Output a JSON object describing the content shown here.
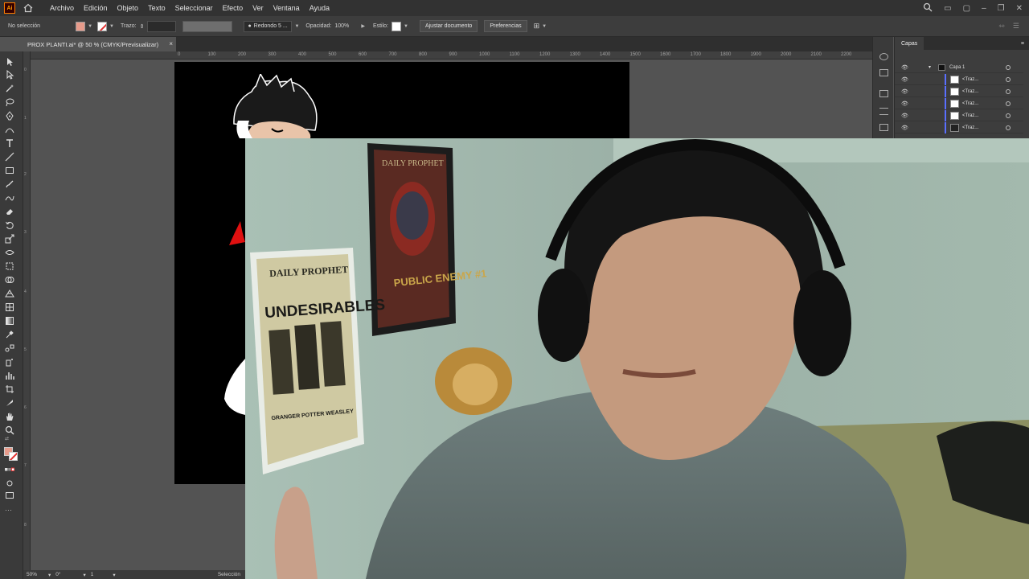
{
  "menubar": {
    "logo": "Ai",
    "items": [
      "Archivo",
      "Edición",
      "Objeto",
      "Texto",
      "Seleccionar",
      "Efecto",
      "Ver",
      "Ventana",
      "Ayuda"
    ]
  },
  "controlbar": {
    "selection": "No selección",
    "stroke_label": "Trazo:",
    "brush": "Redondo 5 ...",
    "opacity_label": "Opacidad:",
    "opacity_value": "100%",
    "style_label": "Estilo:",
    "adjust_button": "Ajustar documento",
    "prefs_button": "Preferencias"
  },
  "document_tab": {
    "title": "PROX PLANTI.ai* @ 50 % (CMYK/Previsualizar)",
    "close": "×"
  },
  "hruler_ticks": [
    "0",
    "100",
    "200",
    "300",
    "400",
    "500",
    "600",
    "700",
    "800",
    "900",
    "1000",
    "1100",
    "1200",
    "1300",
    "1400",
    "1500",
    "1600",
    "1700",
    "1800",
    "1900",
    "2000",
    "2100",
    "2200"
  ],
  "layers_panel": {
    "tab": "Capas",
    "parent": "Capa 1",
    "children": [
      "<Traz...",
      "<Traz...",
      "<Traz...",
      "<Traz...",
      "<Traz..."
    ]
  },
  "statusbar": {
    "zoom": "50%",
    "rotation": "0°",
    "artboard": "1",
    "tool": "Selección"
  },
  "webcam": {
    "poster1_title": "DAILY PROPHET",
    "poster1_headline": "UNDESIRABLES",
    "poster1_names": "GRANGER  POTTER  WEASLEY",
    "poster2_text": "PUBLIC ENEMY #1"
  },
  "colors": {
    "fill": "#e79b8b",
    "stroke_none": "#e23030",
    "layer_accent": "#5a6fff",
    "ai_orange": "#ff9a00"
  }
}
